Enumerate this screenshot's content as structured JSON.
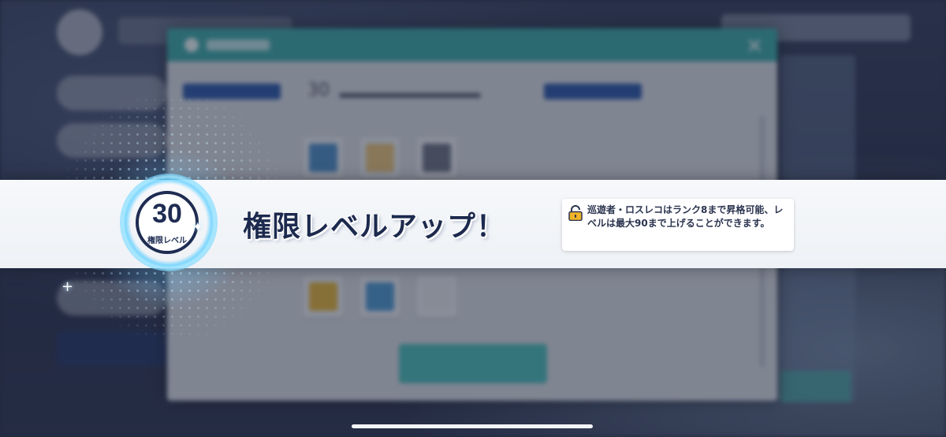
{
  "level_up": {
    "level": "30",
    "level_label": "権限レベル",
    "title": "権限レベルアップ！",
    "info": "巡遊者・ロスレコはランク8まで昇格可能、レベルは最大90まで上げることができます。"
  },
  "icons": {
    "lock": "unlock-padlock-icon",
    "sparkle": "sparkle-icon",
    "close": "close-icon"
  },
  "background_dialog": {
    "level_value": "30",
    "close_glyph": "✕"
  },
  "colors": {
    "badge_navy": "#1e2c52",
    "glow_cyan": "#5acdff",
    "dialog_teal": "#3fa9a8",
    "tag_blue": "#2f5aa8",
    "lock_gold": "#f0b429"
  }
}
